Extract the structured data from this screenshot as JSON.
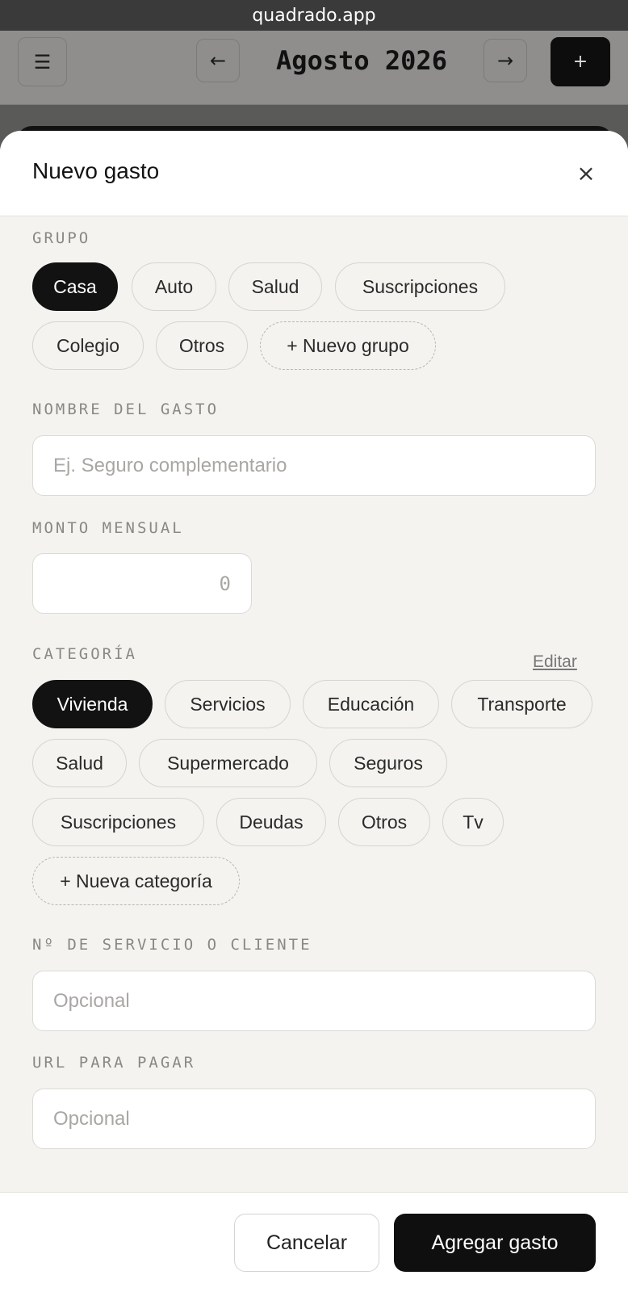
{
  "browser": {
    "url": "quadrado.app"
  },
  "appbar": {
    "menu_icon": "☰",
    "prev_icon": "←",
    "month": "Agosto 2026",
    "next_icon": "→",
    "add_icon": "+"
  },
  "sheet": {
    "title": "Nuevo gasto",
    "close_icon": "×"
  },
  "group": {
    "label": "GRUPO",
    "options": [
      "Casa",
      "Auto",
      "Salud",
      "Suscripciones",
      "Colegio",
      "Otros"
    ],
    "selected": "Casa",
    "new_label": "+ Nuevo grupo"
  },
  "name_field": {
    "label": "NOMBRE DEL GASTO",
    "placeholder": "Ej. Seguro complementario"
  },
  "amount_field": {
    "label": "MONTO MENSUAL",
    "placeholder": "0"
  },
  "category": {
    "label": "CATEGORÍA",
    "edit_label": "Editar",
    "options": [
      "Vivienda",
      "Servicios",
      "Educación",
      "Transporte",
      "Salud",
      "Supermercado",
      "Seguros",
      "Suscripciones",
      "Deudas",
      "Otros",
      "Tv"
    ],
    "selected": "Vivienda",
    "new_label": "+ Nueva categoría"
  },
  "service_field": {
    "label": "Nº DE SERVICIO O CLIENTE",
    "placeholder": "Opcional"
  },
  "url_field": {
    "label": "URL PARA PAGAR",
    "placeholder": "Opcional"
  },
  "footer": {
    "cancel_label": "Cancelar",
    "submit_label": "Agregar gasto"
  }
}
